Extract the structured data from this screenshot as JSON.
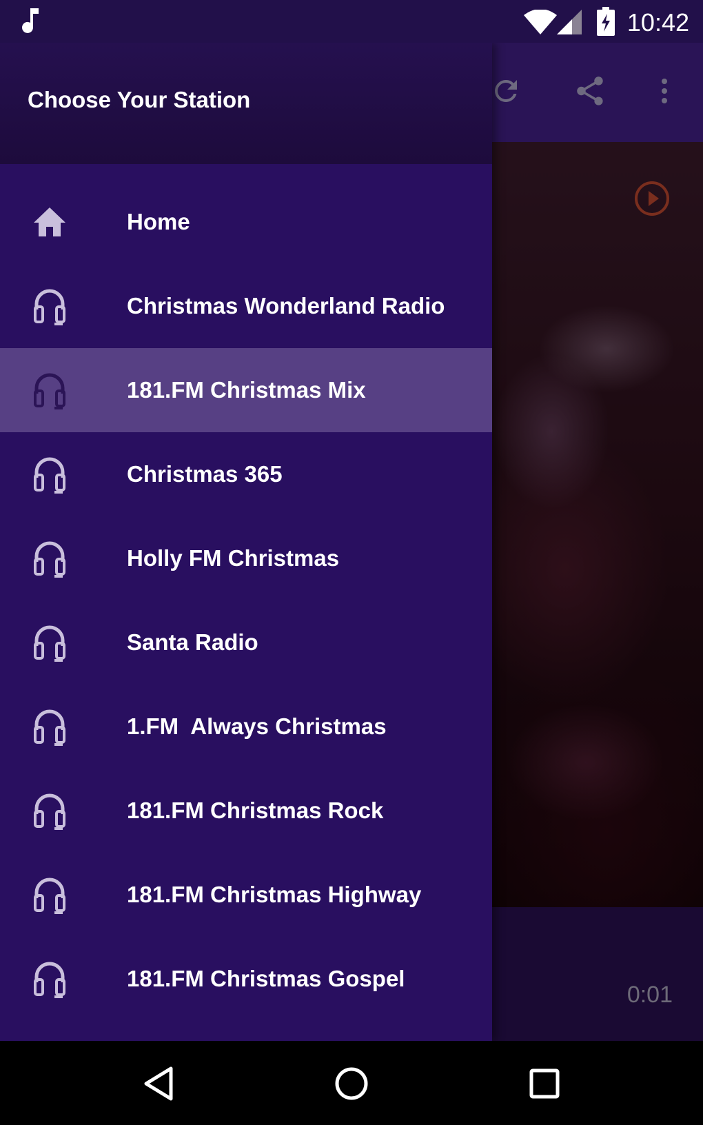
{
  "status_bar": {
    "time": "10:42",
    "icons": [
      "music-note-icon",
      "wifi-icon",
      "cell-signal-icon",
      "battery-charging-icon"
    ]
  },
  "toolbar": {
    "icons": [
      "refresh-icon",
      "share-icon",
      "more-vert-icon"
    ]
  },
  "drawer": {
    "title": "Choose Your Station",
    "items": [
      {
        "label": "Home",
        "icon": "home-icon",
        "selected": false
      },
      {
        "label": "Christmas Wonderland Radio",
        "icon": "headphones-icon",
        "selected": false
      },
      {
        "label": "181.FM Christmas Mix",
        "icon": "headphones-icon",
        "selected": true
      },
      {
        "label": "Christmas 365",
        "icon": "headphones-icon",
        "selected": false
      },
      {
        "label": "Holly FM Christmas",
        "icon": "headphones-icon",
        "selected": false
      },
      {
        "label": "Santa Radio",
        "icon": "headphones-icon",
        "selected": false
      },
      {
        "label": "1.FM  Always Christmas",
        "icon": "headphones-icon",
        "selected": false
      },
      {
        "label": "181.FM Christmas Rock",
        "icon": "headphones-icon",
        "selected": false
      },
      {
        "label": "181.FM Christmas Highway",
        "icon": "headphones-icon",
        "selected": false
      },
      {
        "label": "181.FM Christmas Gospel",
        "icon": "headphones-icon",
        "selected": false
      }
    ]
  },
  "player": {
    "elapsed": "0:01"
  },
  "nav_bar": {
    "icons": [
      "back-icon",
      "home-circle-icon",
      "recents-icon"
    ]
  },
  "colors": {
    "drawer_bg": "#290f60",
    "drawer_header": "#1d0b3c",
    "selected_item": "#574084",
    "icon_tint": "#c9bfdc",
    "selected_icon_tint": "#2b1456"
  }
}
